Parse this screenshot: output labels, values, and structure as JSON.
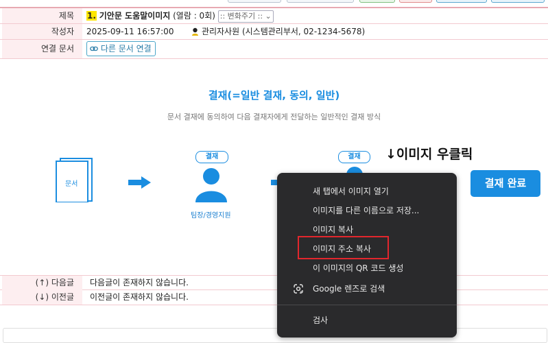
{
  "meta": {
    "subject_label": "제목",
    "subject_number": "1.",
    "subject_title": "기안문 도움말이미지",
    "views": "(열람 : 0회)",
    "change_select": ":: 변화주기 ::",
    "author_label": "작성자",
    "datetime": "2025-09-11 16:57:00",
    "author": "관리자사원 (시스템관리부서, 02-1234-5678)",
    "link_label": "연결 문서",
    "link_button": "다른 문서 연결"
  },
  "diagram": {
    "title": "결재(=일반 결재, 동의, 일반)",
    "subtitle": "문서 결재에 동의하여 다음 결재자에게 전달하는 일반적인 결재 방식",
    "doc_label": "문서",
    "badge1": "결재",
    "person1_caption": "팀장/경영지원",
    "badge2": "결재",
    "done_button": "결재 완료",
    "accent_color": "#1a8de0"
  },
  "annotation": "↓이미지 우클릭",
  "context_menu": {
    "items": [
      "새 탭에서 이미지 열기",
      "이미지를 다른 이름으로 저장...",
      "이미지 복사",
      "이미지 주소 복사",
      "이 이미지의 QR 코드 생성",
      "Google 렌즈로 검색",
      "검사"
    ],
    "highlighted_item": "이미지 주소 복사"
  },
  "nav": {
    "next_label": "(↑) 다음글",
    "next_value": "다음글이 존재하지 않습니다.",
    "prev_label": "(↓) 이전글",
    "prev_value": "이전글이 존재하지 않습니다."
  }
}
